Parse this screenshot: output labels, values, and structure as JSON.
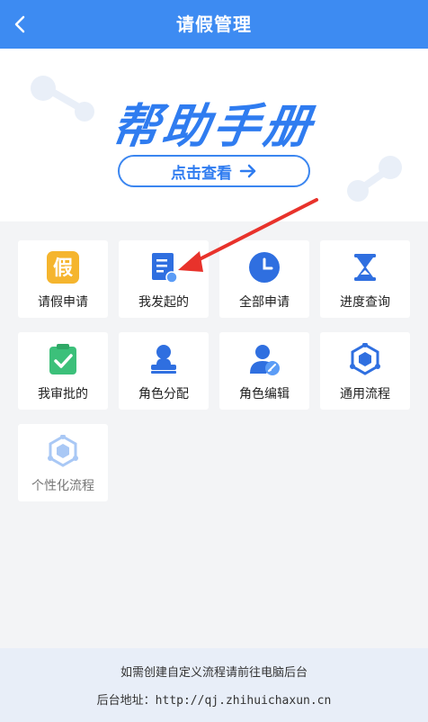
{
  "header": {
    "title": "请假管理"
  },
  "banner": {
    "title": "帮助手册",
    "button_label": "点击查看"
  },
  "grid": {
    "items": [
      {
        "label": "请假申请",
        "icon": "leave-icon"
      },
      {
        "label": "我发起的",
        "icon": "document-icon"
      },
      {
        "label": "全部申请",
        "icon": "clock-icon"
      },
      {
        "label": "进度查询",
        "icon": "hourglass-icon"
      },
      {
        "label": "我审批的",
        "icon": "clipboard-check-icon"
      },
      {
        "label": "角色分配",
        "icon": "user-stamp-icon"
      },
      {
        "label": "角色编辑",
        "icon": "user-edit-icon"
      },
      {
        "label": "通用流程",
        "icon": "hexagon-flow-icon"
      },
      {
        "label": "个性化流程",
        "icon": "hexagon-flow-light-icon"
      }
    ]
  },
  "footer": {
    "line1": "如需创建自定义流程请前往电脑后台",
    "line2_label": "后台地址：",
    "line2_url": "http://qj.zhihuichaxun.cn"
  },
  "colors": {
    "primary": "#3d8bf2",
    "accent_yellow": "#f5b52e",
    "accent_green": "#3cc07a",
    "annotation_red": "#e8322b"
  }
}
